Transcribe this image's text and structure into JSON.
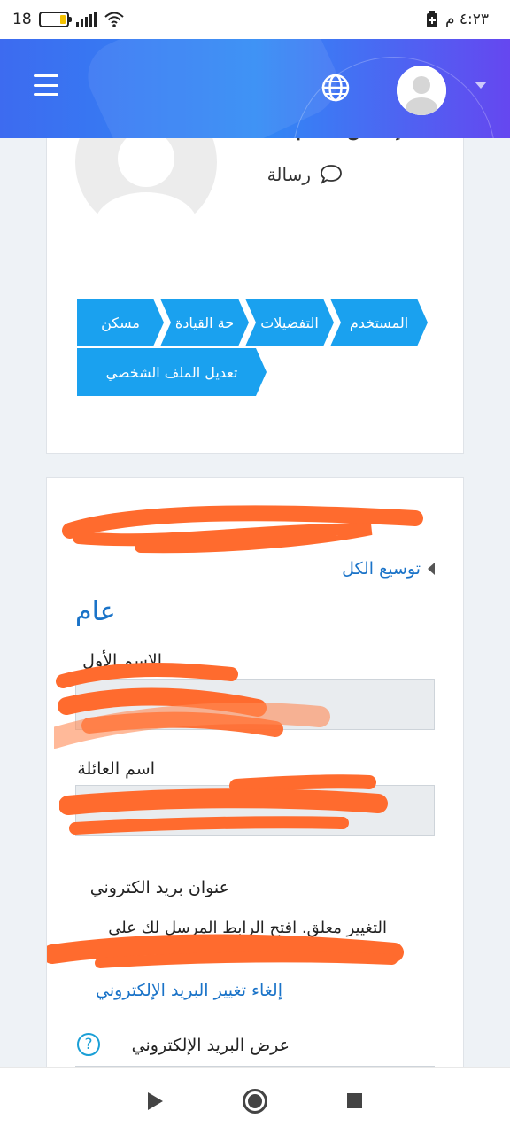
{
  "status_bar": {
    "battery_level": "18",
    "time": "٤:٢٣ م"
  },
  "profile": {
    "name_fragment": "إيناس عالم",
    "message_label": "رسالة"
  },
  "breadcrumbs": {
    "row1": [
      "المستخدم",
      "التفضيلات",
      "حة القيادة",
      "مسكن"
    ],
    "row2": [
      "تعديل الملف الشخصي"
    ]
  },
  "form": {
    "expand_all": "توسيع الكل",
    "section_title": "عام",
    "first_name_label": "الاسم الأول",
    "last_name_label": "اسم العائلة",
    "email_label": "عنوان بريد الكتروني",
    "email_pending_text": "التغيير معلق. افتح الرابط المرسل لك على",
    "cancel_email_change": "إلغاء تغيير البريد الإلكتروني",
    "email_display_label": "عرض البريد الإلكتروني",
    "help_icon_text": "?"
  },
  "colors": {
    "brand_blue": "#1aa1ef",
    "link_blue": "#1a73c8",
    "redaction": "#ff6b2e"
  },
  "icons": [
    "menu-icon",
    "globe-icon",
    "user-avatar-icon",
    "chat-bubble-icon",
    "help-icon",
    "back-icon",
    "home-icon",
    "recents-icon"
  ]
}
